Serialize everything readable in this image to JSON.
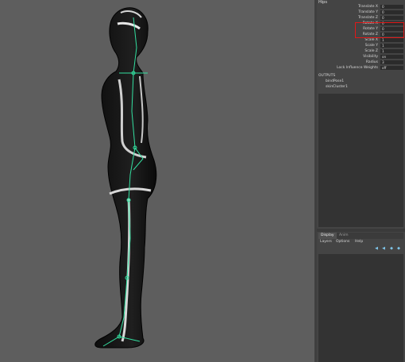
{
  "channel_box": {
    "header": "Hips",
    "attributes": [
      {
        "label": "Translate X",
        "value": "0"
      },
      {
        "label": "Translate Y",
        "value": "0"
      },
      {
        "label": "Translate Z",
        "value": "0"
      },
      {
        "label": "Rotate X",
        "value": "0"
      },
      {
        "label": "Rotate Y",
        "value": "0"
      },
      {
        "label": "Rotate Z",
        "value": "0"
      },
      {
        "label": "Scale X",
        "value": "1"
      },
      {
        "label": "Scale Y",
        "value": "1"
      },
      {
        "label": "Scale Z",
        "value": "1"
      },
      {
        "label": "Visibility",
        "value": "on"
      },
      {
        "label": "Radius",
        "value": "3"
      },
      {
        "label": "Lock Influence Weights",
        "value": "off"
      }
    ],
    "outputs_label": "OUTPUTS",
    "outputs": [
      "bindPose1",
      "skinCluster1"
    ]
  },
  "layer_editor": {
    "tabs": [
      "Display",
      "Anim"
    ],
    "menu": [
      "Layers",
      "Options",
      "Help"
    ],
    "icons": [
      "move-layer-up-icon",
      "move-layer-down-icon",
      "new-layer-icon",
      "new-layer-from-selected-icon"
    ]
  },
  "colors": {
    "viewport_bg": "#5e5e5e",
    "panel_bg": "#444444",
    "highlight": "#e01818",
    "skeleton": "#33e0a0"
  }
}
